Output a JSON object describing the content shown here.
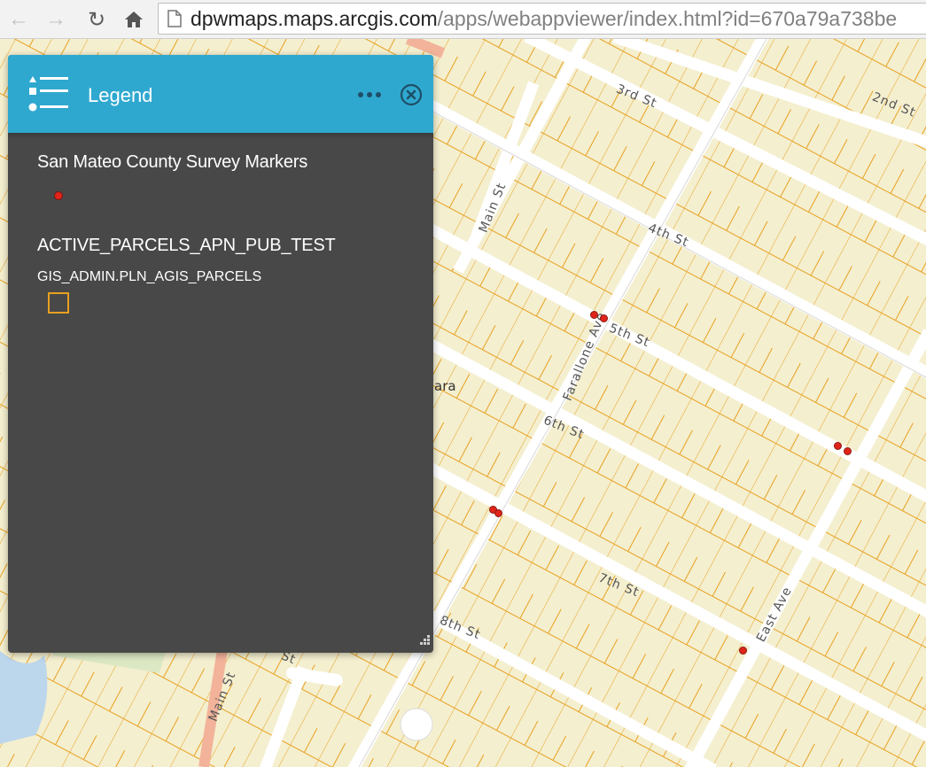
{
  "browser": {
    "url_host": "dpwmaps.maps.arcgis.com",
    "url_path": "/apps/webappviewer/index.html?id=670a79a738be",
    "icons": [
      "back-icon",
      "forward-icon",
      "reload-icon",
      "home-icon",
      "page-icon"
    ]
  },
  "legend": {
    "title": "Legend",
    "layers": [
      {
        "title": "San Mateo County Survey Markers",
        "symbol": "red-dot"
      },
      {
        "title": "ACTIVE_PARCELS_APN_PUB_TEST",
        "sublayer": "GIS_ADMIN.PLN_AGIS_PARCELS",
        "symbol": "orange-outline-square"
      }
    ]
  },
  "map": {
    "streets": [
      "3rd St",
      "2nd St",
      "4th St",
      "Main St",
      "Farallone Ave",
      "5th St",
      "6th St",
      "7th St",
      "8th St",
      "East Ave",
      "Main St",
      "St"
    ],
    "place_label": "ara"
  },
  "colors": {
    "header": "#2fa8d0",
    "panel": "#484848",
    "marker": "#e0241a",
    "parcel_line": "#e8a020",
    "land": "#f4efcf",
    "road": "#ffffff"
  }
}
